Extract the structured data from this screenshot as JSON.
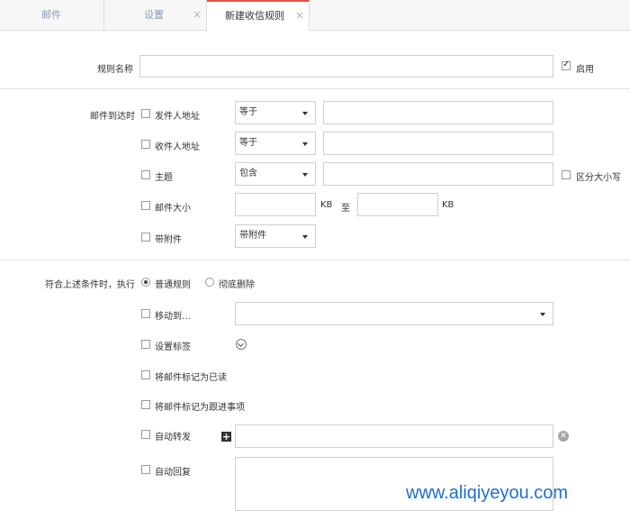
{
  "tabs": [
    {
      "label": "邮件"
    },
    {
      "label": "设置",
      "close": "×"
    },
    {
      "label": "新建收信规则",
      "close": "×"
    }
  ],
  "rule_name": {
    "label": "规则名称",
    "value": "",
    "enable_label": "启用",
    "enabled": true
  },
  "conditions": {
    "label": "邮件到达时",
    "sender": {
      "label": "发件人地址",
      "operator": "等于",
      "value": ""
    },
    "recipient": {
      "label": "收件人地址",
      "operator": "等于",
      "value": ""
    },
    "subject": {
      "label": "主题",
      "operator": "包含",
      "value": "",
      "case_label": "区分大小写"
    },
    "size": {
      "label": "邮件大小",
      "from": "",
      "unit_from": "KB",
      "to_label": "至",
      "to": "",
      "unit_to": "KB"
    },
    "attachment": {
      "label": "带附件",
      "operator": "带附件"
    }
  },
  "actions": {
    "label": "符合上述条件时，执行",
    "normal_rule": "普通规则",
    "delete_forever": "彻底删除",
    "move_to": "移动到…",
    "set_tag": "设置标签",
    "mark_read": "将邮件标记为已读",
    "mark_followup": "将邮件标记为跟进事项",
    "auto_forward": "自动转发",
    "auto_reply": "自动回复"
  },
  "watermark": "www.aliqiyeyou.com"
}
